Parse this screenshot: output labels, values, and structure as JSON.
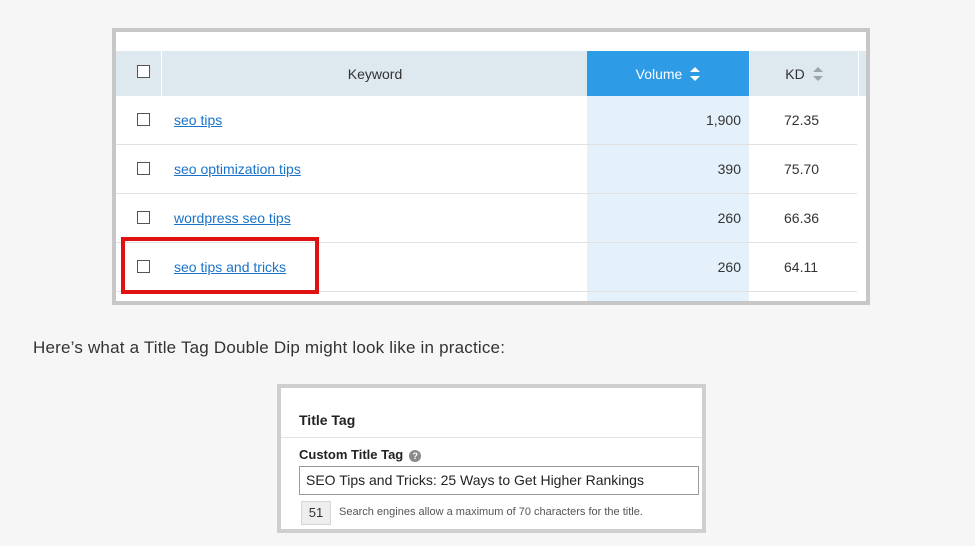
{
  "keyword_table": {
    "headers": {
      "keyword": "Keyword",
      "volume": "Volume",
      "kd": "KD"
    },
    "rows": [
      {
        "keyword": "seo tips",
        "volume": "1,900",
        "kd": "72.35"
      },
      {
        "keyword": "seo optimization tips",
        "volume": "390",
        "kd": "75.70"
      },
      {
        "keyword": "wordpress seo tips",
        "volume": "260",
        "kd": "66.36"
      },
      {
        "keyword": "seo tips and tricks",
        "volume": "260",
        "kd": "64.11"
      }
    ],
    "highlighted_row": 3,
    "colors": {
      "volume_header": "#2d9be6",
      "link": "#1a73c9",
      "highlight": "#e01111"
    }
  },
  "caption": "Here’s what a Title Tag Double Dip might look like in practice:",
  "title_tag_panel": {
    "heading": "Title Tag",
    "field_label": "Custom Title Tag",
    "help_icon": "question-circle-icon",
    "input_value": "SEO Tips and Tricks: 25 Ways to Get Higher Rankings",
    "char_count": "51",
    "hint": "Search engines allow a maximum of 70 characters for the title."
  }
}
